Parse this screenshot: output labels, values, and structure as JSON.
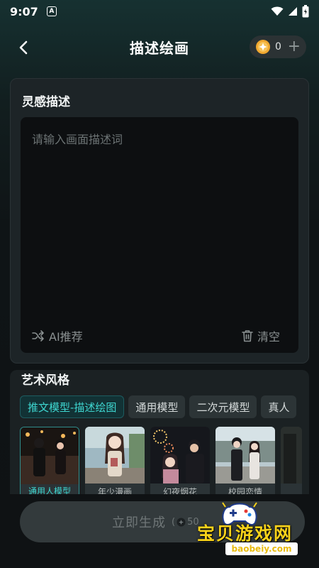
{
  "status": {
    "time": "9:07",
    "notif": "A"
  },
  "header": {
    "title": "描述绘画",
    "coins": "0"
  },
  "prompt_card": {
    "title": "灵感描述",
    "placeholder": "请输入画面描述词",
    "ai_label": "AI推荐",
    "clear_label": "清空"
  },
  "style": {
    "title": "艺术风格",
    "tabs": [
      {
        "label": "推文模型-描述绘图"
      },
      {
        "label": "通用模型"
      },
      {
        "label": "二次元模型"
      },
      {
        "label": "真人"
      }
    ],
    "thumbs": [
      {
        "label": "通用人模型"
      },
      {
        "label": "年少漫画"
      },
      {
        "label": "幻夜烟花"
      },
      {
        "label": "校园恋情"
      }
    ]
  },
  "generate": {
    "label": "立即生成",
    "cost": "50"
  },
  "watermark": {
    "text": "宝贝游戏网",
    "url": "baobeiy.com"
  },
  "colors": {
    "accent": "#3ed6d0",
    "coin": "#f0a830",
    "watermark": "#f7d21a"
  }
}
